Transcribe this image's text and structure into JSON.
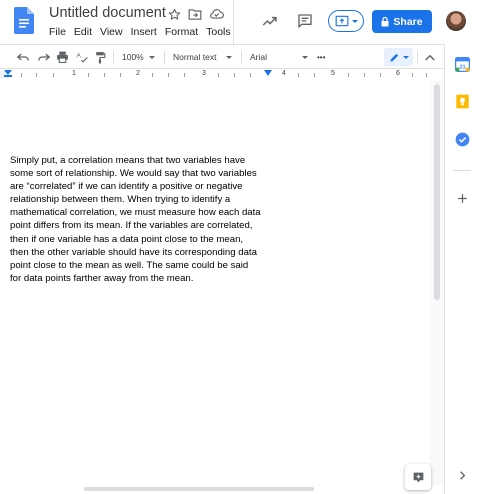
{
  "header": {
    "title": "Untitled document",
    "menu": [
      "File",
      "Edit",
      "View",
      "Insert",
      "Format",
      "Tools"
    ],
    "share_label": "Share",
    "icons": [
      "docs-logo-icon",
      "star-icon",
      "move-folder-icon",
      "cloud-status-icon",
      "activity-trend-icon",
      "comment-icon",
      "present-icon",
      "lock-icon",
      "avatar"
    ]
  },
  "toolbar": {
    "zoom": "100%",
    "style": "Normal text",
    "font": "Arial",
    "more": "•••",
    "icons": [
      "undo-icon",
      "redo-icon",
      "print-icon",
      "spellcheck-icon",
      "paint-format-icon",
      "edit-mode-pencil-icon",
      "collapse-chevron-up-icon"
    ]
  },
  "ruler": {
    "numbers": [
      "1",
      "2",
      "3",
      "4",
      "5",
      "6"
    ]
  },
  "document": {
    "body": "Simply put, a correlation means that two variables have\nsome sort of relationship.  We would say that two variables\nare “correlated” if we can identify a positive or negative\nrelationship between them.  When trying to identify a\nmathematical correlation, we must measure how each data\npoint differs from its mean.  If the variables are correlated,\nthen if one variable has a data point close to the mean,\nthen the other variable should have its corresponding data\npoint close to the mean as well.  The same could be said\nfor data points farther away from the mean."
  },
  "side_panel": {
    "icons": [
      "calendar-icon",
      "keep-icon",
      "tasks-icon",
      "add-icon",
      "expand-chevron-right-icon"
    ]
  },
  "colors": {
    "accent": "#1a73e8",
    "docs_blue": "#4285f4",
    "keep_yellow": "#fbbc04"
  }
}
